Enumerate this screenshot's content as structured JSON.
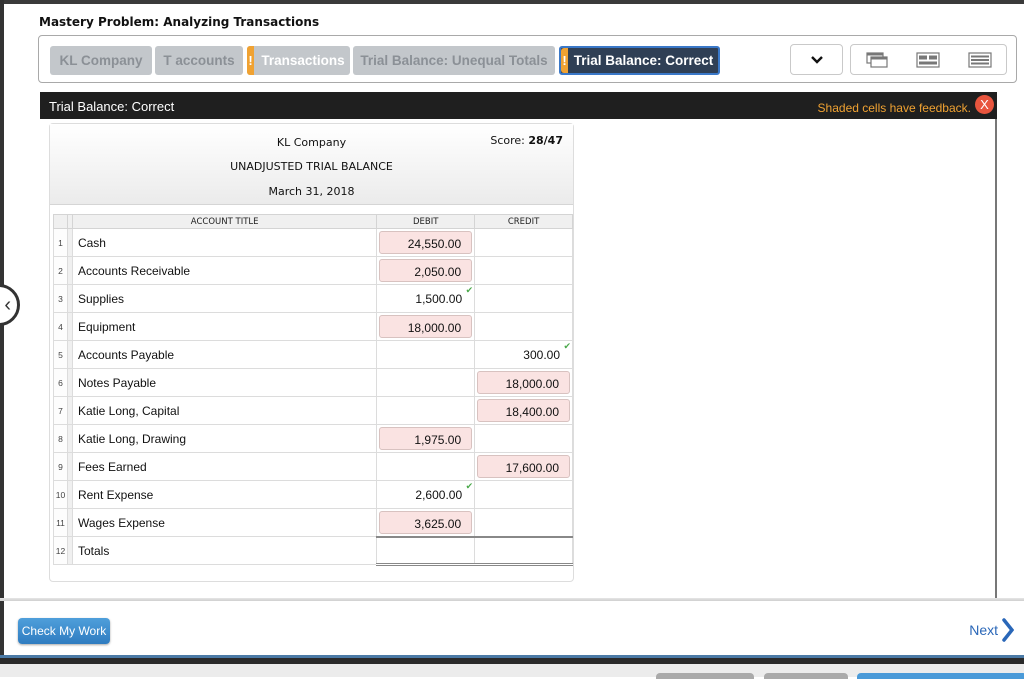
{
  "problem": {
    "title": "Mastery Problem: Analyzing Transactions"
  },
  "tabs": [
    {
      "label": "KL Company",
      "flagged": false,
      "active": false
    },
    {
      "label": "T accounts",
      "flagged": false,
      "active": false
    },
    {
      "label": "Transactions",
      "flagged": true,
      "active": false
    },
    {
      "label": "Trial Balance: Unequal Totals",
      "flagged": false,
      "active": false
    },
    {
      "label": "Trial Balance: Correct",
      "flagged": true,
      "active": true
    }
  ],
  "tab_flag_glyph": "!",
  "toolbar": {
    "dropdown_icon": "chevron-down-icon",
    "view_icons": [
      "cascade-windows-icon",
      "split-panels-icon",
      "list-view-icon"
    ]
  },
  "panel": {
    "title": "Trial Balance: Correct",
    "feedback_note": "Shaded cells have feedback.",
    "close_glyph": "X"
  },
  "sheet": {
    "company": "KL Company",
    "statement": "UNADJUSTED TRIAL BALANCE",
    "date": "March 31, 2018",
    "score_label": "Score:",
    "score_value": "28/47",
    "columns": {
      "account": "ACCOUNT TITLE",
      "debit": "DEBIT",
      "credit": "CREDIT"
    },
    "rows": [
      {
        "num": "1",
        "account": "Cash",
        "debit": "24,550.00",
        "debit_state": "feedback",
        "credit": "",
        "credit_state": "empty"
      },
      {
        "num": "2",
        "account": "Accounts Receivable",
        "debit": "2,050.00",
        "debit_state": "feedback",
        "credit": "",
        "credit_state": "empty"
      },
      {
        "num": "3",
        "account": "Supplies",
        "debit": "1,500.00",
        "debit_state": "correct",
        "credit": "",
        "credit_state": "empty"
      },
      {
        "num": "4",
        "account": "Equipment",
        "debit": "18,000.00",
        "debit_state": "feedback",
        "credit": "",
        "credit_state": "empty"
      },
      {
        "num": "5",
        "account": "Accounts Payable",
        "debit": "",
        "debit_state": "empty",
        "credit": "300.00",
        "credit_state": "correct"
      },
      {
        "num": "6",
        "account": "Notes Payable",
        "debit": "",
        "debit_state": "empty",
        "credit": "18,000.00",
        "credit_state": "feedback"
      },
      {
        "num": "7",
        "account": "Katie Long, Capital",
        "debit": "",
        "debit_state": "empty",
        "credit": "18,400.00",
        "credit_state": "feedback"
      },
      {
        "num": "8",
        "account": "Katie Long, Drawing",
        "debit": "1,975.00",
        "debit_state": "feedback",
        "credit": "",
        "credit_state": "empty"
      },
      {
        "num": "9",
        "account": "Fees Earned",
        "debit": "",
        "debit_state": "empty",
        "credit": "17,600.00",
        "credit_state": "feedback"
      },
      {
        "num": "10",
        "account": "Rent Expense",
        "debit": "2,600.00",
        "debit_state": "correct",
        "credit": "",
        "credit_state": "empty"
      },
      {
        "num": "11",
        "account": "Wages Expense",
        "debit": "3,625.00",
        "debit_state": "feedback",
        "credit": "",
        "credit_state": "empty"
      },
      {
        "num": "12",
        "account": "Totals",
        "debit": "",
        "debit_state": "empty",
        "credit": "",
        "credit_state": "empty"
      }
    ],
    "check_glyph": "✔"
  },
  "footer": {
    "check_button": "Check My Work",
    "next_label": "Next"
  },
  "colors": {
    "feedback_shade": "#fae3e2",
    "correct_check": "#4aa84a",
    "flag_orange": "#f0a232",
    "active_tab": "#2f3f55",
    "primary_blue": "#2f7cc0"
  }
}
